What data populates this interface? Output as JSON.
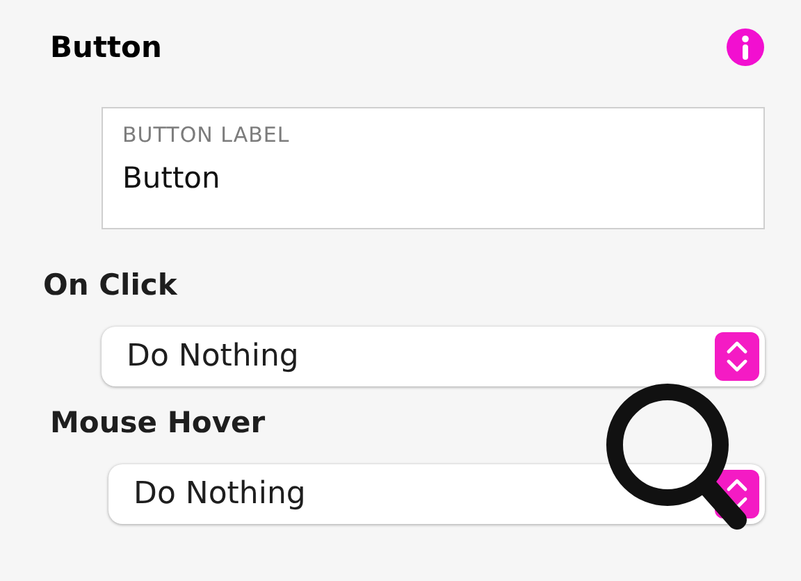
{
  "section": {
    "title": "Button"
  },
  "label_field": {
    "label": "BUTTON LABEL",
    "value": "Button"
  },
  "dropdowns": [
    {
      "label": "On Click",
      "value": "Do Nothing"
    },
    {
      "label": "Mouse Hover",
      "value": "Do Nothing"
    }
  ]
}
